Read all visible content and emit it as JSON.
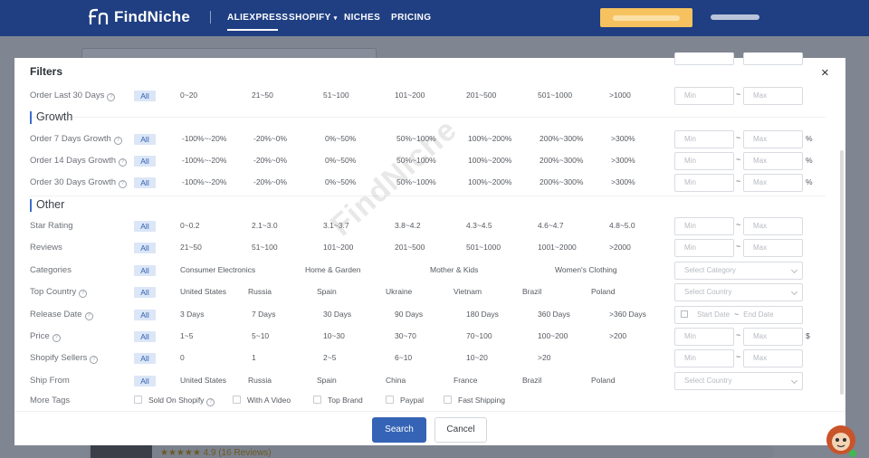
{
  "nav": {
    "brand": "FindNiche",
    "items": [
      "ALIEXPRESS",
      "SHOPIFY",
      "NICHES",
      "PRICING"
    ],
    "active": "ALIEXPRESS"
  },
  "background": {
    "stars": "★★★★★",
    "rating_text": "4.9 (16 Reviews)"
  },
  "modal": {
    "title": "Filters",
    "close": "×",
    "all_label": "All",
    "min_placeholder": "Min",
    "max_placeholder": "Max",
    "tilde": "~",
    "rows": {
      "order30": {
        "label": "Order Last 30 Days",
        "options": [
          "0~20",
          "21~50",
          "51~100",
          "101~200",
          "201~500",
          "501~1000",
          ">1000"
        ]
      },
      "order7g": {
        "label": "Order 7 Days Growth",
        "options": [
          "-100%~-20%",
          "-20%~0%",
          "0%~50%",
          "50%~100%",
          "100%~200%",
          "200%~300%",
          ">300%"
        ],
        "unit": "%"
      },
      "order14g": {
        "label": "Order 14 Days Growth",
        "options": [
          "-100%~-20%",
          "-20%~0%",
          "0%~50%",
          "50%~100%",
          "100%~200%",
          "200%~300%",
          ">300%"
        ],
        "unit": "%"
      },
      "order30g": {
        "label": "Order 30 Days Growth",
        "options": [
          "-100%~-20%",
          "-20%~0%",
          "0%~50%",
          "50%~100%",
          "100%~200%",
          "200%~300%",
          ">300%"
        ],
        "unit": "%"
      },
      "star": {
        "label": "Star Rating",
        "options": [
          "0~0.2",
          "2.1~3.0",
          "3.1~3.7",
          "3.8~4.2",
          "4.3~4.5",
          "4.6~4.7",
          "4.8~5.0"
        ]
      },
      "reviews": {
        "label": "Reviews",
        "options": [
          "21~50",
          "51~100",
          "101~200",
          "201~500",
          "501~1000",
          "1001~2000",
          ">2000"
        ]
      },
      "categories": {
        "label": "Categories",
        "options": [
          "Consumer Electronics",
          "Home & Garden",
          "Mother & Kids",
          "Women's Clothing"
        ],
        "select_placeholder": "Select Category"
      },
      "country": {
        "label": "Top Country",
        "options": [
          "United States",
          "Russia",
          "Spain",
          "Ukraine",
          "Vietnam",
          "Brazil",
          "Poland"
        ],
        "select_placeholder": "Select Country"
      },
      "release": {
        "label": "Release Date",
        "options": [
          "3 Days",
          "7 Days",
          "30 Days",
          "90 Days",
          "180 Days",
          "360 Days",
          ">360 Days"
        ],
        "start_placeholder": "Start Date",
        "end_placeholder": "End Date"
      },
      "price": {
        "label": "Price",
        "options": [
          "1~5",
          "5~10",
          "10~30",
          "30~70",
          "70~100",
          "100~200",
          ">200"
        ],
        "unit": "$"
      },
      "sellers": {
        "label": "Shopify Sellers",
        "options": [
          "0",
          "1",
          "2~5",
          "6~10",
          "10~20",
          ">20"
        ]
      },
      "shipfrom": {
        "label": "Ship From",
        "options": [
          "United States",
          "Russia",
          "Spain",
          "China",
          "France",
          "Brazil",
          "Poland"
        ],
        "select_placeholder": "Select Country"
      },
      "tags": {
        "label": "More Tags",
        "options": [
          "Sold On Shopify",
          "With A Video",
          "Top Brand",
          "Paypal",
          "Fast Shipping"
        ]
      }
    },
    "sections": {
      "growth": "Growth",
      "other": "Other"
    },
    "buttons": {
      "search": "Search",
      "cancel": "Cancel"
    },
    "watermark": "FindNiche"
  },
  "colors": {
    "nav_bg": "#1f3f82",
    "accent": "#3563b5",
    "chip_bg": "#dbe6f7",
    "promo": "#f6c25f"
  }
}
